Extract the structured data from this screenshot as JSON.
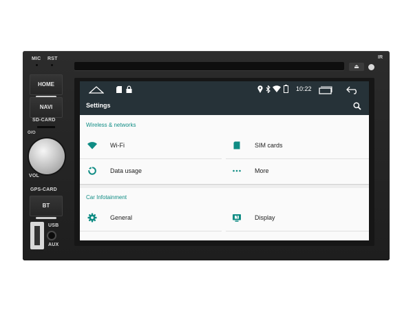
{
  "hardware": {
    "mic_label": "MIC",
    "rst_label": "RST",
    "home_label": "HOME",
    "navi_label": "NAVI",
    "sdcard_label": "SD-CARD",
    "power_label": "O/⏻",
    "vol_label": "VOL",
    "gpscard_label": "GPS-CARD",
    "bt_label": "BT",
    "usb_label": "USB",
    "aux_label": "AUX",
    "ir_label": "IR",
    "eject_glyph": "⏏"
  },
  "status_bar": {
    "time": "10:22",
    "icons": [
      "home-outline-icon",
      "sd-card-icon",
      "lock-icon",
      "location-icon",
      "bluetooth-icon",
      "wifi-icon",
      "battery-icon",
      "recent-apps-icon",
      "back-icon"
    ]
  },
  "action_bar": {
    "title": "Settings",
    "search_icon": "search-icon"
  },
  "sections": [
    {
      "header": "Wireless & networks",
      "items": [
        {
          "label": "Wi-Fi",
          "icon": "wifi-icon"
        },
        {
          "label": "SIM cards",
          "icon": "sim-card-icon"
        },
        {
          "label": "Data usage",
          "icon": "data-usage-icon"
        },
        {
          "label": "More",
          "icon": "more-dots-icon"
        }
      ]
    },
    {
      "header": "Car Infotainment",
      "items": [
        {
          "label": "General",
          "icon": "gear-icon"
        },
        {
          "label": "Display",
          "icon": "display-icon"
        }
      ]
    }
  ],
  "colors": {
    "accent": "#0f8c84",
    "bar": "#263238",
    "card": "#fafafa",
    "screen_bg": "#eeeeee"
  }
}
